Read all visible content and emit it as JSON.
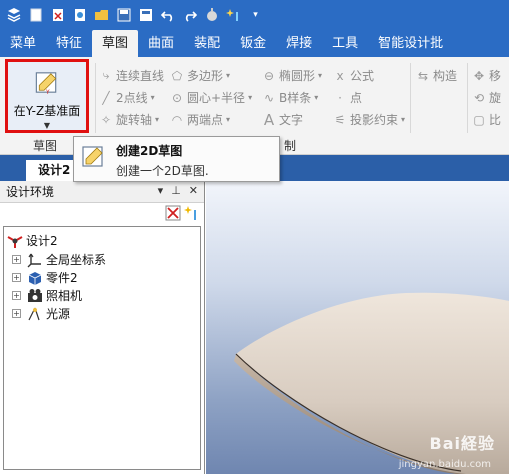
{
  "menu_tabs": [
    "菜单",
    "特征",
    "草图",
    "曲面",
    "装配",
    "钣金",
    "焊接",
    "工具",
    "智能设计批"
  ],
  "ribbon": {
    "big_button_label": "在Y-Z基准面",
    "group_label_left": "草图",
    "group_label_right": "制",
    "items": {
      "continuous_line": "连续直线",
      "polygon": "多边形",
      "ellipse": "椭圆形",
      "formula": "公式",
      "construct": "构造",
      "move": "移",
      "two_point_line": "2点线",
      "circle_center_radius": "圆心+半径",
      "bspline": "B样条",
      "point": "点",
      "rotate": "旋",
      "revolve_axis": "旋转轴",
      "two_vertex": "两端点",
      "text": "文字",
      "projection_constraint": "投影约束",
      "ratio": "比"
    }
  },
  "tooltip": {
    "title": "创建2D草图",
    "description": "创建一个2D草图."
  },
  "doc_tab": "设计2",
  "panel": {
    "title": "设计环境",
    "tree": [
      "设计2",
      "全局坐标系",
      "零件2",
      "照相机",
      "光源"
    ]
  },
  "watermark": {
    "brand": "Bai経验",
    "url": "jingyan.baidu.com"
  }
}
